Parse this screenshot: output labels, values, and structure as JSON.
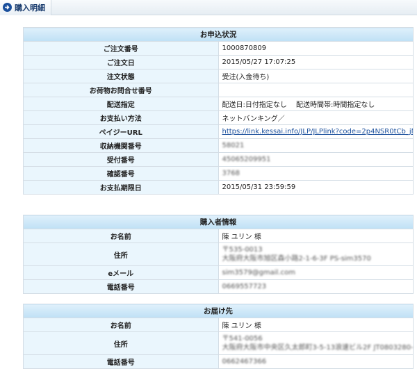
{
  "header": {
    "title": "購入明細"
  },
  "order": {
    "title": "お申込状況",
    "rows": [
      {
        "label": "ご注文番号",
        "value": "1000870809"
      },
      {
        "label": "ご注文日",
        "value": "2015/05/27 17:07:25"
      },
      {
        "label": "注文状態",
        "value": "受注(入金待ち)"
      },
      {
        "label": "お荷物お問合せ番号",
        "value": ""
      },
      {
        "label": "配送指定",
        "value": "配送日:日付指定なし　 配送時間帯:時間指定なし"
      },
      {
        "label": "お支払い方法",
        "value": "ネットバンキング／"
      },
      {
        "label": "ペイジーURL",
        "value": "https://link.kessai.info/JLP/JLPlink?code=2p4NSR0tCb_jN43Gc0SL&rdxm=1"
      },
      {
        "label": "収納機関番号",
        "value": "58021"
      },
      {
        "label": "受付番号",
        "value": "45065209951"
      },
      {
        "label": "確認番号",
        "value": "3768"
      },
      {
        "label": "お支払期限日",
        "value": "2015/05/31 23:59:59"
      }
    ]
  },
  "buyer": {
    "title": "購入者情報",
    "name_label": "お名前",
    "name": "陳 ユリン 様",
    "address_label": "住所",
    "address_line1": "〒535-0013",
    "address_line2": "大阪府大阪市旭区森小路2-1-6-3F PS-sim3570",
    "email_label": "eメール",
    "email": "sim3579@gmail.com",
    "phone_label": "電話番号",
    "phone": "0669557723"
  },
  "shipping": {
    "title": "お届け先",
    "name_label": "お名前",
    "name": "陳 ユリン 様",
    "address_label": "住所",
    "address_line1": "〒541-0056",
    "address_line2": "大阪府大阪市中央区久太郎町3-5-13浪速ビル2F JT0803280-01",
    "phone_label": "電話番号",
    "phone": "0662467366"
  }
}
